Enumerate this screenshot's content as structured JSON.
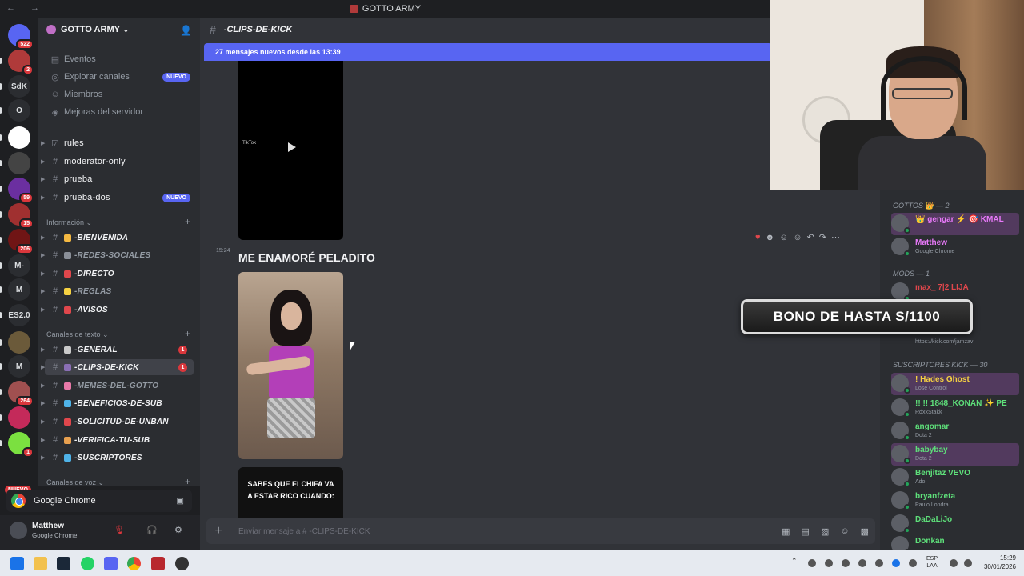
{
  "window": {
    "title": "GOTTO ARMY"
  },
  "guilds": {
    "mentions_badge": "522",
    "items": [
      {
        "label": "",
        "badge": ""
      },
      {
        "label": "",
        "badge": "2"
      },
      {
        "label": "SdK",
        "badge": ""
      },
      {
        "label": "O",
        "badge": ""
      },
      {
        "label": "",
        "badge": ""
      },
      {
        "label": "",
        "badge": ""
      },
      {
        "label": "",
        "badge": "59"
      },
      {
        "label": "",
        "badge": "15"
      },
      {
        "label": "",
        "badge": "206"
      },
      {
        "label": "M-",
        "badge": ""
      },
      {
        "label": "M",
        "badge": ""
      },
      {
        "label": "ES2.0",
        "badge": ""
      },
      {
        "label": "",
        "badge": ""
      },
      {
        "label": "M",
        "badge": ""
      },
      {
        "label": "",
        "badge": "264"
      },
      {
        "label": "",
        "badge": ""
      },
      {
        "label": "",
        "badge": "1"
      }
    ],
    "nuevo_label": "NUEVO"
  },
  "server": {
    "name": "GOTTO ARMY",
    "top_items": [
      {
        "label": "Eventos",
        "icon": "calendar-icon"
      },
      {
        "label": "Explorar canales",
        "icon": "compass-icon",
        "tag": "NUEVO"
      },
      {
        "label": "Miembros",
        "icon": "members-icon"
      },
      {
        "label": "Mejoras del servidor",
        "icon": "boost-icon"
      }
    ],
    "channels_top": [
      {
        "name": "rules",
        "icon": "rules-icon"
      },
      {
        "name": "moderator-only",
        "icon": "hash-icon"
      },
      {
        "name": "prueba",
        "icon": "hash-icon"
      },
      {
        "name": "prueba-dos",
        "icon": "hash-icon",
        "tag": "NUEVO"
      }
    ],
    "cat_info": "Información",
    "channels_info": [
      {
        "name": "-BIENVENIDA",
        "emoji_color": "#f5b942",
        "bright": true
      },
      {
        "name": "-REDES-SOCIALES",
        "emoji_color": "#8a8f98",
        "bright": false
      },
      {
        "name": "-DIRECTO",
        "emoji_color": "#e0474c",
        "bright": true
      },
      {
        "name": "-REGLAS",
        "emoji_color": "#f5d142",
        "bright": false
      },
      {
        "name": "-AVISOS",
        "emoji_color": "#e0474c",
        "bright": true
      }
    ],
    "cat_text": "Canales de texto",
    "channels_text": [
      {
        "name": "-GENERAL",
        "emoji_color": "#c9c9c9",
        "bright": true,
        "count": "1"
      },
      {
        "name": "-CLIPS-DE-KICK",
        "emoji_color": "#8a6fb5",
        "bright": true,
        "count": "1",
        "active": true
      },
      {
        "name": "-MEMES-DEL-GOTTO",
        "emoji_color": "#e879a8",
        "bright": false
      },
      {
        "name": "-BENEFICIOS-DE-SUB",
        "emoji_color": "#4fb3e8",
        "bright": true
      },
      {
        "name": "-SOLICITUD-DE-UNBAN",
        "emoji_color": "#e0474c",
        "bright": true
      },
      {
        "name": "-VERIFICA-TU-SUB",
        "emoji_color": "#e8a04f",
        "bright": true
      },
      {
        "name": "-SUSCRIPTORES",
        "emoji_color": "#4fb3e8",
        "bright": true
      }
    ],
    "cat_voice": "Canales de voz"
  },
  "activity": {
    "app": "Google Chrome"
  },
  "user": {
    "name": "Matthew",
    "status": "Google Chrome"
  },
  "channel": {
    "name": "-CLIPS-DE-KICK",
    "new_banner": "27 mensajes nuevos desde las 13:39",
    "tiktok_label": "TikTok",
    "timestamp": "15:24",
    "message_title": "ME ENAMORÉ PELADITO",
    "video3_caption": "SABES QUE ELCHIFA VA A ESTAR RICO CUANDO:",
    "input_placeholder": "Enviar mensaje a #  -CLIPS-DE-KICK"
  },
  "overlay": {
    "text": "BONO DE HASTA S/1100"
  },
  "members": {
    "cat_gottos": "GOTTOS 👑 — 2",
    "gottos": [
      {
        "name": "👑 gengar ⚡ 🎯 KMAL",
        "sub": "",
        "color": "#e879f9",
        "hl": true
      },
      {
        "name": "Matthew",
        "sub": "Google Chrome",
        "color": "#e879f9",
        "hl": false
      }
    ],
    "cat_mods": "MODS — 1",
    "mods": [
      {
        "name": "max_ 7|2  LIJA",
        "sub": "",
        "color": "#e0474c"
      }
    ],
    "link": "https://kick.com/jamzav",
    "cat_subs": "SUSCRIPTORES KICK — 30",
    "subs": [
      {
        "name": "! Hades  Ghost",
        "sub": "Lose Control",
        "color": "#f5d142",
        "hl": true
      },
      {
        "name": "!! !! 1848_KONAN ✨ PE",
        "sub": "RdxxStakk",
        "color": "#5ee07a",
        "hl": false
      },
      {
        "name": "angomar",
        "sub": "Dota 2",
        "color": "#5ee07a",
        "hl": false
      },
      {
        "name": "babybay",
        "sub": "Dota 2",
        "color": "#5ee07a",
        "hl": true
      },
      {
        "name": "Benjitaz  VEVO",
        "sub": "Ado",
        "color": "#5ee07a",
        "hl": false
      },
      {
        "name": "bryanfzeta",
        "sub": "Paulo Londra",
        "color": "#5ee07a",
        "hl": false
      },
      {
        "name": "DaDaLiJo",
        "sub": "",
        "color": "#5ee07a",
        "hl": false
      },
      {
        "name": "Donkan",
        "sub": "",
        "color": "#5ee07a",
        "hl": false
      }
    ]
  },
  "taskbar": {
    "lang": "ESP\nLAA",
    "time": "15:29",
    "date": "30/01/2026"
  }
}
